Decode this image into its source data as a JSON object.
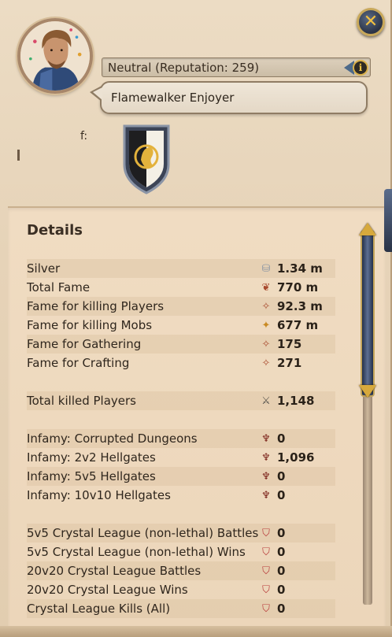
{
  "header": {
    "reputation_text": "Neutral (Reputation: 259)",
    "title_text": "Flamewalker Enjoyer",
    "guild_label": "f:"
  },
  "icons": {
    "close": "close-icon",
    "info": "info-icon",
    "avatar": "character-portrait",
    "guild": "guild-shield-icon"
  },
  "details": {
    "title": "Details",
    "rows": [
      {
        "label": "Silver",
        "value": "1.34 m",
        "icon": "silver-icon"
      },
      {
        "label": "Total Fame",
        "value": "770 m",
        "icon": "fame-icon"
      },
      {
        "label": "Fame for killing Players",
        "value": "92.3 m",
        "icon": "pvp-fame-icon"
      },
      {
        "label": "Fame for killing Mobs",
        "value": "677 m",
        "icon": "pve-fame-icon"
      },
      {
        "label": "Fame for Gathering",
        "value": "175",
        "icon": "gathering-fame-icon"
      },
      {
        "label": "Fame for Crafting",
        "value": "271",
        "icon": "crafting-fame-icon"
      },
      {
        "label": "Total killed Players",
        "value": "1,148",
        "icon": "swords-icon"
      },
      {
        "label": "Infamy: Corrupted Dungeons",
        "value": "0",
        "icon": "infamy-icon"
      },
      {
        "label": "Infamy: 2v2 Hellgates",
        "value": "1,096",
        "icon": "infamy-icon"
      },
      {
        "label": "Infamy: 5v5 Hellgates",
        "value": "0",
        "icon": "infamy-icon"
      },
      {
        "label": "Infamy: 10v10 Hellgates",
        "value": "0",
        "icon": "infamy-icon"
      },
      {
        "label": "5v5 Crystal League (non-lethal) Battles",
        "value": "0",
        "icon": "crystal-league-icon"
      },
      {
        "label": "5v5 Crystal League (non-lethal) Wins",
        "value": "0",
        "icon": "crystal-league-icon"
      },
      {
        "label": "20v20 Crystal League Battles",
        "value": "0",
        "icon": "crystal-league-icon"
      },
      {
        "label": "20v20 Crystal League Wins",
        "value": "0",
        "icon": "crystal-league-icon"
      },
      {
        "label": "Crystal League Kills (All)",
        "value": "0",
        "icon": "crystal-league-icon"
      }
    ]
  },
  "colors": {
    "parchment": "#ecdcc4",
    "text": "#2f261d",
    "accent_gold": "#d7a93c",
    "accent_blue": "#2b3346"
  }
}
